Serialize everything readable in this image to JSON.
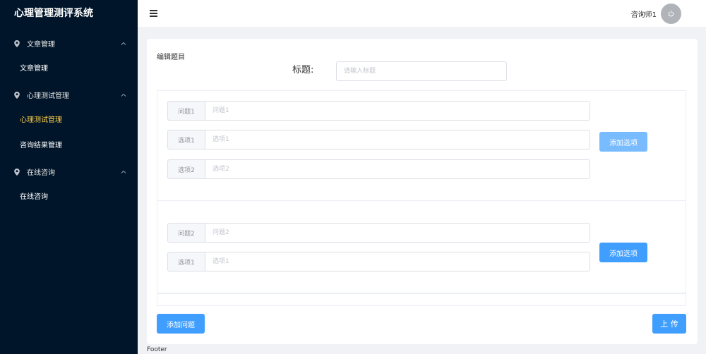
{
  "app": {
    "title": "心理管理测评系统"
  },
  "sidebar": {
    "groups": [
      {
        "label": "文章管理",
        "items": [
          {
            "label": "文章管理"
          }
        ]
      },
      {
        "label": "心理测试管理",
        "items": [
          {
            "label": "心理测试管理",
            "active": true
          },
          {
            "label": "咨询结果管理"
          }
        ]
      },
      {
        "label": "在线咨询",
        "items": [
          {
            "label": "在线咨询"
          }
        ]
      }
    ]
  },
  "header": {
    "username": "咨询师1",
    "menu_icon": "hamburger-icon",
    "avatar_icon": "power-icon"
  },
  "main": {
    "page_label": "编辑题目",
    "title_label": "标题:",
    "title_placeholder": "请输入标题",
    "questions": [
      {
        "prefix": "问题1",
        "placeholder": "问题1",
        "options": [
          {
            "prefix": "选项1",
            "placeholder": "选项1"
          },
          {
            "prefix": "选项2",
            "placeholder": "选项2"
          }
        ],
        "add_option_label": "添加选项"
      },
      {
        "prefix": "问题2",
        "placeholder": "问题2",
        "options": [
          {
            "prefix": "选项1",
            "placeholder": "选项1"
          }
        ],
        "add_option_label": "添加选项"
      }
    ],
    "add_question_label": "添加问题",
    "upload_label": "上 传"
  },
  "footer": {
    "text": "Footer"
  },
  "colors": {
    "sidebar_bg": "#001529",
    "active_menu": "#ffd04b",
    "primary": "#409eff",
    "primary_light": "#79bbff"
  }
}
